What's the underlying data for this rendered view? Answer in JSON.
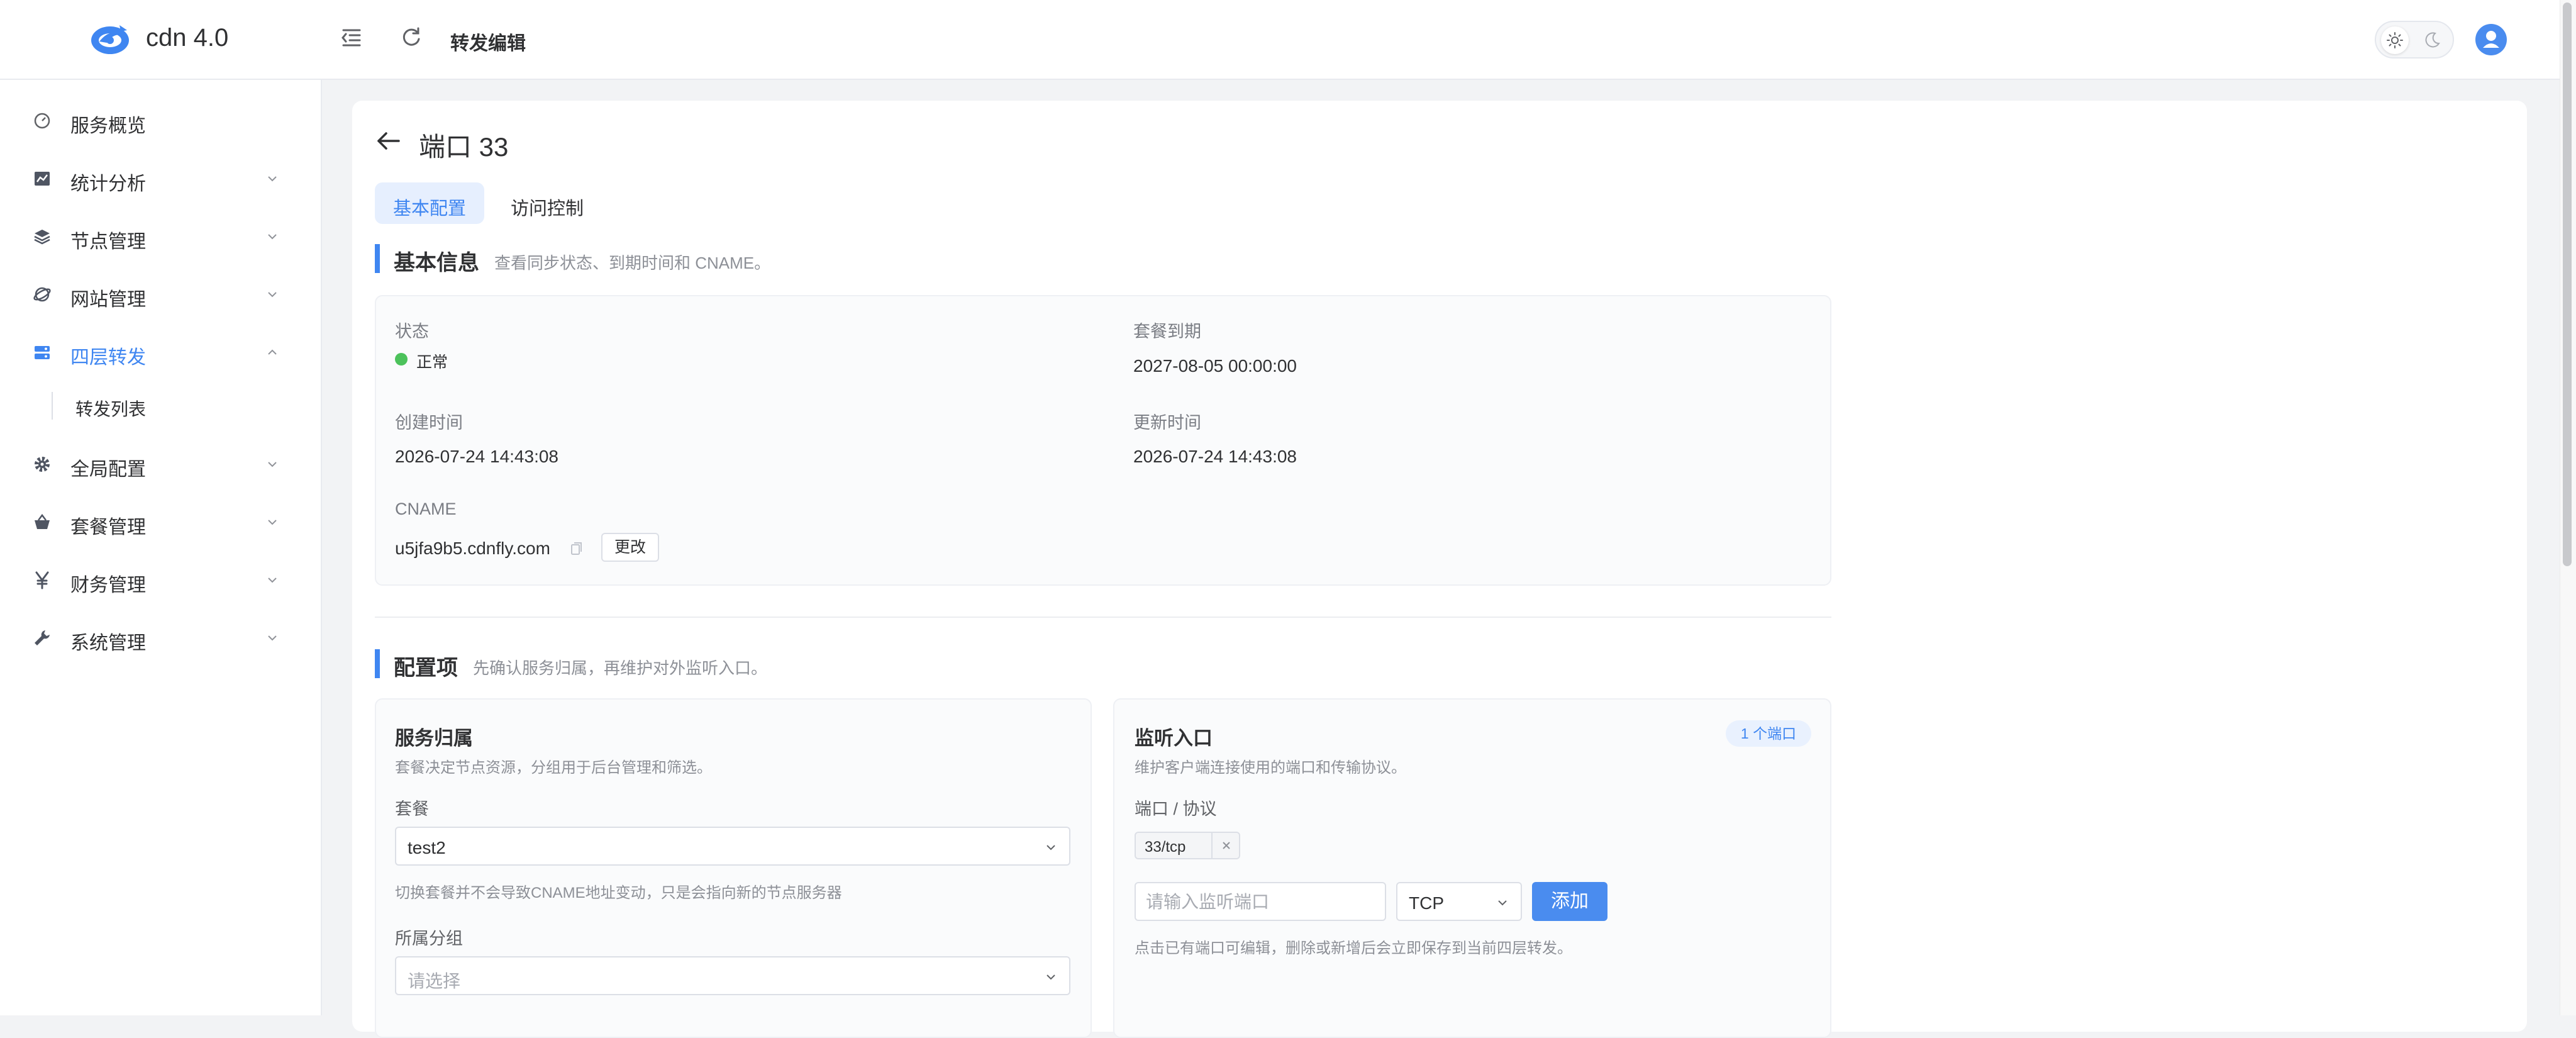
{
  "app": {
    "title": "cdn 4.0"
  },
  "header": {
    "page_title": "转发编辑"
  },
  "sidebar": {
    "items": [
      {
        "label": "服务概览",
        "icon": "dashboard-icon"
      },
      {
        "label": "统计分析",
        "icon": "chart-icon"
      },
      {
        "label": "节点管理",
        "icon": "layers-icon"
      },
      {
        "label": "网站管理",
        "icon": "globe-icon"
      },
      {
        "label": "四层转发",
        "icon": "forward-icon",
        "active": true
      },
      {
        "label": "全局配置",
        "icon": "gear-icon"
      },
      {
        "label": "套餐管理",
        "icon": "basket-icon"
      },
      {
        "label": "财务管理",
        "icon": "yen-icon"
      },
      {
        "label": "系统管理",
        "icon": "wrench-icon"
      }
    ],
    "sub_items": [
      {
        "label": "转发列表"
      }
    ]
  },
  "main": {
    "title": "端口 33",
    "tabs": [
      {
        "label": "基本配置",
        "active": true
      },
      {
        "label": "访问控制"
      }
    ],
    "basic_info": {
      "title": "基本信息",
      "desc": "查看同步状态、到期时间和 CNAME。",
      "status_label": "状态",
      "status_value": "正常",
      "expire_label": "套餐到期",
      "expire_value": "2027-08-05 00:00:00",
      "created_label": "创建时间",
      "created_value": "2026-07-24 14:43:08",
      "updated_label": "更新时间",
      "updated_value": "2026-07-24 14:43:08",
      "cname_label": "CNAME",
      "cname_value": "u5jfa9b5.cdnfly.com",
      "change_button": "更改"
    },
    "config": {
      "title": "配置项",
      "desc": "先确认服务归属，再维护对外监听入口。",
      "service": {
        "title": "服务归属",
        "desc": "套餐决定节点资源，分组用于后台管理和筛选。",
        "plan_label": "套餐",
        "plan_value": "test2",
        "plan_hint": "切换套餐并不会导致CNAME地址变动，只是会指向新的节点服务器",
        "group_label": "所属分组",
        "group_placeholder": "请选择"
      },
      "listen": {
        "title": "监听入口",
        "desc": "维护客户端连接使用的端口和传输协议。",
        "badge": "1 个端口",
        "port_label": "端口 / 协议",
        "port_tag": "33/tcp",
        "port_placeholder": "请输入监听端口",
        "protocol_value": "TCP",
        "add_button": "添加",
        "hint": "点击已有端口可编辑，删除或新增后会立即保存到当前四层转发。"
      }
    }
  },
  "colors": {
    "accent": "#3f86f1",
    "status_ok": "#4cc25b",
    "background": "#f2f3f5"
  }
}
